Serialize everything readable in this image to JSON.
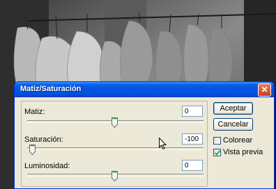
{
  "dialog": {
    "title": "Matiz/Saturación",
    "close_icon": "close-icon"
  },
  "sliders": [
    {
      "label": "Matiz:",
      "value": "0",
      "level": 0.5
    },
    {
      "label": "Saturación:",
      "value": "-100",
      "level": 0.0
    },
    {
      "label": "Luminosidad:",
      "value": "0",
      "level": 0.5
    }
  ],
  "buttons": {
    "ok_label": "Aceptar",
    "cancel_label": "Cancelar"
  },
  "options": {
    "colorize_label": "Colorear",
    "colorize_checked": false,
    "preview_label": "Vista previa",
    "preview_checked": true
  },
  "colors": {
    "titlebar": "#0054e3",
    "dialog_bg": "#ece9d8",
    "close_button": "#c73c19",
    "check_mark": "#21a121"
  }
}
